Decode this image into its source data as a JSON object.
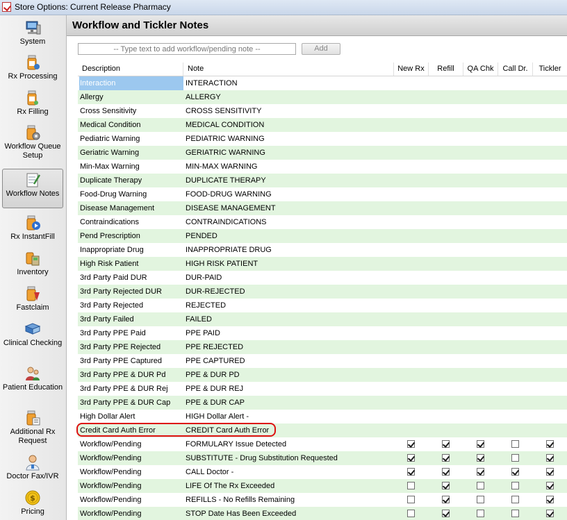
{
  "window": {
    "title": "Store Options: Current Release Pharmacy"
  },
  "sidebar": {
    "items": [
      {
        "label": "System",
        "icon": "computer-icon",
        "active": false
      },
      {
        "label": "Rx Processing",
        "icon": "pill-bottle-icon",
        "active": false
      },
      {
        "label": "Rx Filling",
        "icon": "pill-bottle-icon",
        "active": false
      },
      {
        "label": "Workflow Queue Setup",
        "icon": "pill-bottle-gear-icon",
        "active": false
      },
      {
        "label": "Workflow Notes",
        "icon": "notepad-icon",
        "active": true
      },
      {
        "label": "Rx InstantFill",
        "icon": "instantfill-icon",
        "active": false
      },
      {
        "label": "Inventory",
        "icon": "inventory-icon",
        "active": false
      },
      {
        "label": "Fastclaim",
        "icon": "fastclaim-icon",
        "active": false
      },
      {
        "label": "Clinical Checking",
        "icon": "clinical-book-icon",
        "active": false
      },
      {
        "label": "Patient Education",
        "icon": "patients-icon",
        "active": false
      },
      {
        "label": "Additional Rx Request",
        "icon": "rx-request-icon",
        "active": false
      },
      {
        "label": "Doctor Fax/IVR",
        "icon": "doctor-icon",
        "active": false
      },
      {
        "label": "Pricing",
        "icon": "coin-icon",
        "active": false
      }
    ]
  },
  "main": {
    "title": "Workflow and Tickler Notes",
    "input": {
      "placeholder": "-- Type text to add workflow/pending note --",
      "value": ""
    },
    "add_label": "Add"
  },
  "grid": {
    "columns": [
      "Description",
      "Note",
      "New Rx",
      "Refill",
      "QA Chk",
      "Call Dr.",
      "Tickler"
    ],
    "rows": [
      {
        "desc": "Interaction",
        "note": "INTERACTION",
        "selected": true
      },
      {
        "desc": "Allergy",
        "note": "ALLERGY"
      },
      {
        "desc": "Cross Sensitivity",
        "note": "CROSS SENSITIVITY"
      },
      {
        "desc": "Medical Condition",
        "note": "MEDICAL CONDITION"
      },
      {
        "desc": "Pediatric Warning",
        "note": "PEDIATRIC WARNING"
      },
      {
        "desc": "Geriatric Warning",
        "note": "GERIATRIC WARNING"
      },
      {
        "desc": "Min-Max Warning",
        "note": "MIN-MAX WARNING"
      },
      {
        "desc": "Duplicate Therapy",
        "note": "DUPLICATE THERAPY"
      },
      {
        "desc": "Food-Drug Warning",
        "note": "FOOD-DRUG WARNING"
      },
      {
        "desc": "Disease Management",
        "note": "DISEASE MANAGEMENT"
      },
      {
        "desc": "Contraindications",
        "note": "CONTRAINDICATIONS"
      },
      {
        "desc": "Pend Prescription",
        "note": "PENDED"
      },
      {
        "desc": "Inappropriate Drug",
        "note": "INAPPROPRIATE DRUG"
      },
      {
        "desc": "High Risk Patient",
        "note": "HIGH RISK PATIENT"
      },
      {
        "desc": "3rd Party Paid DUR",
        "note": "DUR-PAID"
      },
      {
        "desc": "3rd Party Rejected DUR",
        "note": "DUR-REJECTED"
      },
      {
        "desc": "3rd Party Rejected",
        "note": "REJECTED"
      },
      {
        "desc": "3rd Party Failed",
        "note": "FAILED"
      },
      {
        "desc": "3rd Party PPE Paid",
        "note": "PPE PAID"
      },
      {
        "desc": "3rd Party PPE Rejected",
        "note": "PPE REJECTED"
      },
      {
        "desc": "3rd Party PPE Captured",
        "note": "PPE CAPTURED"
      },
      {
        "desc": "3rd Party PPE & DUR Pd",
        "note": "PPE & DUR PD"
      },
      {
        "desc": "3rd Party PPE & DUR Rej",
        "note": "PPE & DUR REJ"
      },
      {
        "desc": "3rd Party PPE & DUR Cap",
        "note": "PPE & DUR CAP"
      },
      {
        "desc": "High Dollar Alert",
        "note": "HIGH Dollar Alert -"
      },
      {
        "desc": "Credit Card Auth Error",
        "note": "CREDIT Card Auth Error"
      },
      {
        "desc": "Workflow/Pending",
        "note": "FORMULARY Issue Detected",
        "checks": [
          true,
          true,
          true,
          false,
          true
        ]
      },
      {
        "desc": "Workflow/Pending",
        "note": "SUBSTITUTE - Drug Substitution Requested",
        "checks": [
          true,
          true,
          true,
          false,
          true
        ]
      },
      {
        "desc": "Workflow/Pending",
        "note": "CALL Doctor -",
        "checks": [
          true,
          true,
          true,
          true,
          true
        ]
      },
      {
        "desc": "Workflow/Pending",
        "note": "LIFE Of The Rx Exceeded",
        "checks": [
          false,
          true,
          false,
          false,
          true
        ]
      },
      {
        "desc": "Workflow/Pending",
        "note": "REFILLS - No Refills Remaining",
        "checks": [
          false,
          true,
          false,
          false,
          true
        ]
      },
      {
        "desc": "Workflow/Pending",
        "note": "STOP Date Has Been Exceeded",
        "checks": [
          false,
          true,
          false,
          false,
          true
        ]
      }
    ]
  }
}
